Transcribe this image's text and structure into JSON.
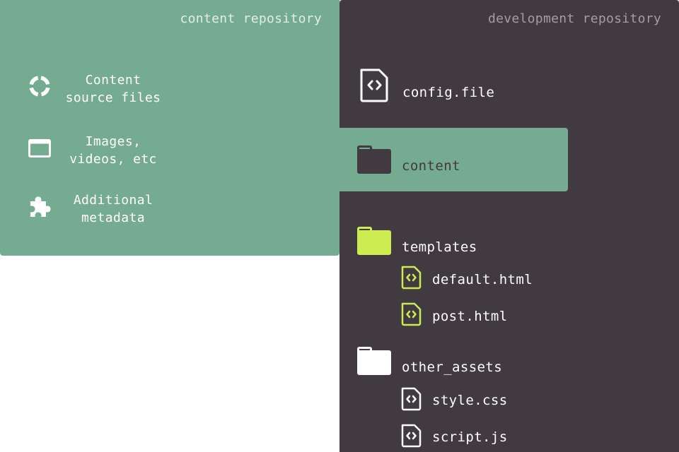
{
  "colors": {
    "content_bg": "#75ab90",
    "dev_bg": "#413a40",
    "highlight_bg": "#75ab90",
    "lime": "#cdec52",
    "title_content": "#e2eee5",
    "title_dev": "#a49ea3",
    "white": "#ffffff",
    "dark_text": "#3f3a3e"
  },
  "content_repo": {
    "title": "content repository",
    "items": [
      {
        "icon": "circle-arc-icon",
        "label": "Content\nsource files"
      },
      {
        "icon": "window-icon",
        "label": "Images,\nvideos, etc"
      },
      {
        "icon": "puzzle-piece-icon",
        "label": "Additional\nmetadata"
      }
    ]
  },
  "dev_repo": {
    "title": "development repository",
    "config": {
      "icon": "code-file-icon",
      "label": "config.file"
    },
    "content_folder": {
      "icon": "folder-icon",
      "label": "content"
    },
    "templates": {
      "icon": "folder-icon",
      "label": "templates",
      "files": [
        {
          "icon": "code-file-icon",
          "label": "default.html"
        },
        {
          "icon": "code-file-icon",
          "label": "post.html"
        }
      ]
    },
    "other_assets": {
      "icon": "folder-icon",
      "label": "other_assets",
      "files": [
        {
          "icon": "code-file-icon",
          "label": "style.css"
        },
        {
          "icon": "code-file-icon",
          "label": "script.js"
        }
      ]
    }
  }
}
